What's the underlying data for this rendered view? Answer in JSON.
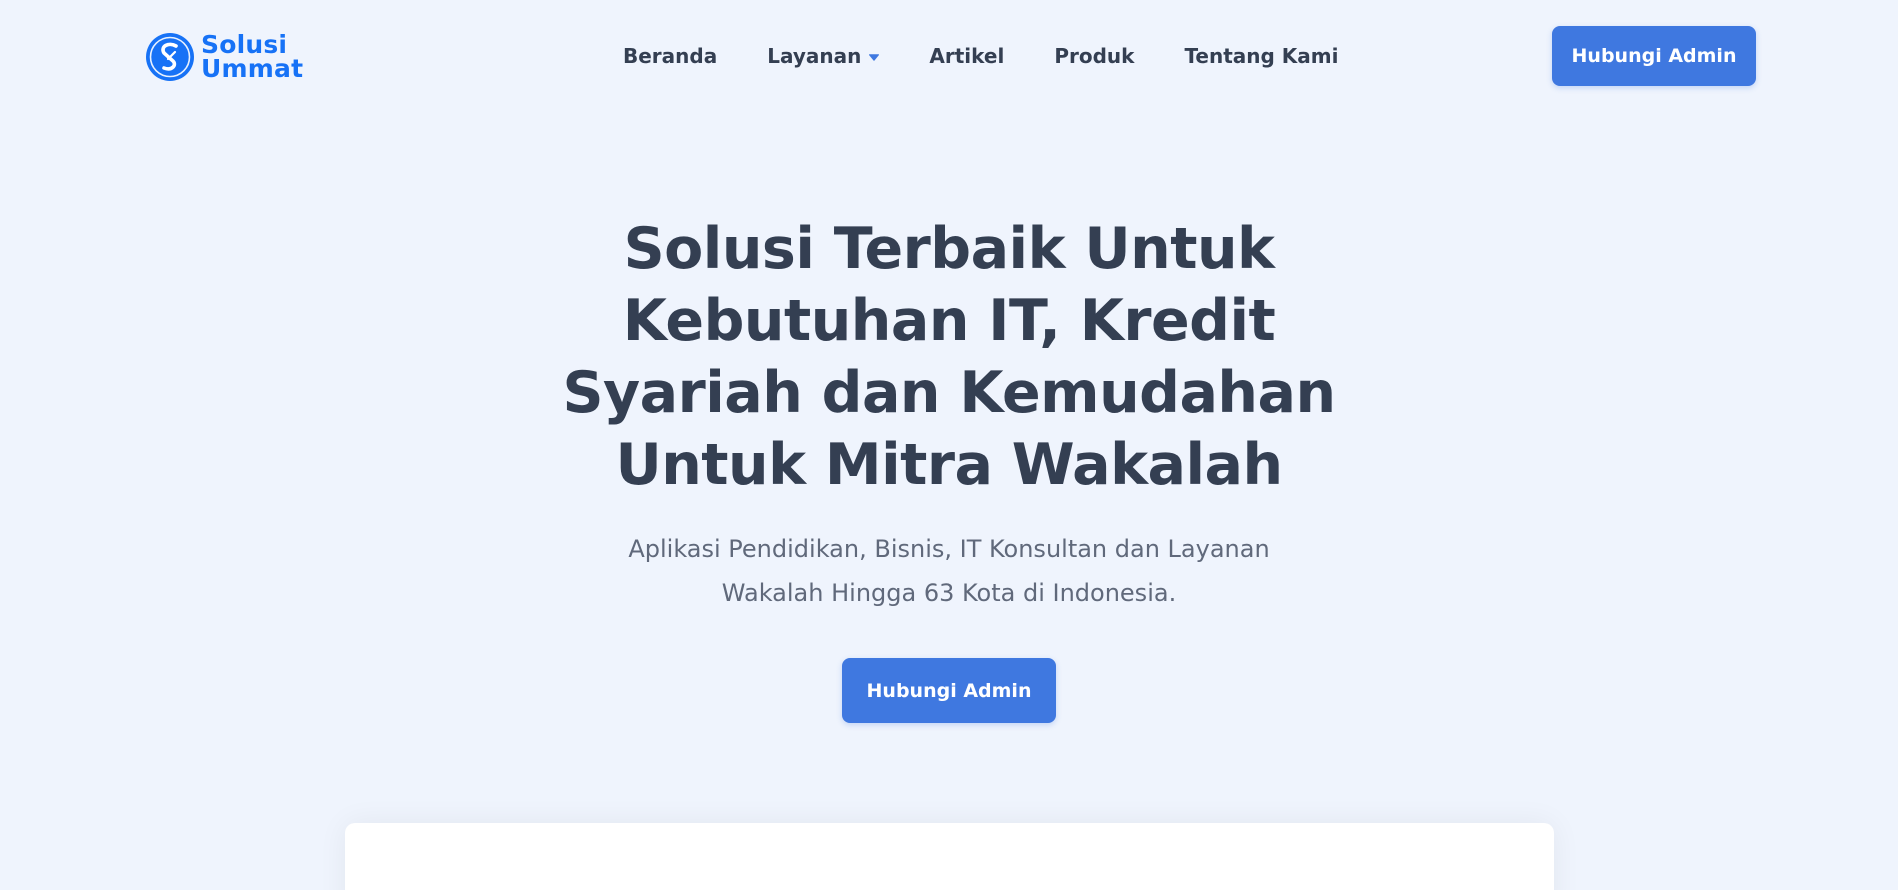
{
  "brand": {
    "name_line1": "Solusi",
    "name_line2": "Ummat",
    "logo_icon": "solusi-ummat-logo-icon",
    "color": "#1772f6"
  },
  "nav": {
    "items": [
      {
        "label": "Beranda",
        "has_dropdown": false
      },
      {
        "label": "Layanan",
        "has_dropdown": true
      },
      {
        "label": "Artikel",
        "has_dropdown": false
      },
      {
        "label": "Produk",
        "has_dropdown": false
      },
      {
        "label": "Tentang Kami",
        "has_dropdown": false
      }
    ],
    "dropdown_icon": "caret-down-icon"
  },
  "header": {
    "cta_label": "Hubungi Admin"
  },
  "hero": {
    "title_lines": [
      "Solusi Terbaik Untuk",
      "Kebutuhan IT, Kredit",
      "Syariah dan Kemudahan",
      "Untuk Mitra Wakalah"
    ],
    "subtitle_lines": [
      "Aplikasi Pendidikan, Bisnis, IT Konsultan dan Layanan",
      "Wakalah Hingga 63 Kota di Indonesia."
    ],
    "cta_label": "Hubungi Admin"
  },
  "colors": {
    "background": "#eff4fd",
    "primary_button": "#3f78e0",
    "heading": "#343f52",
    "body_text": "#60697b",
    "dropdown_caret": "#3f78e0"
  }
}
